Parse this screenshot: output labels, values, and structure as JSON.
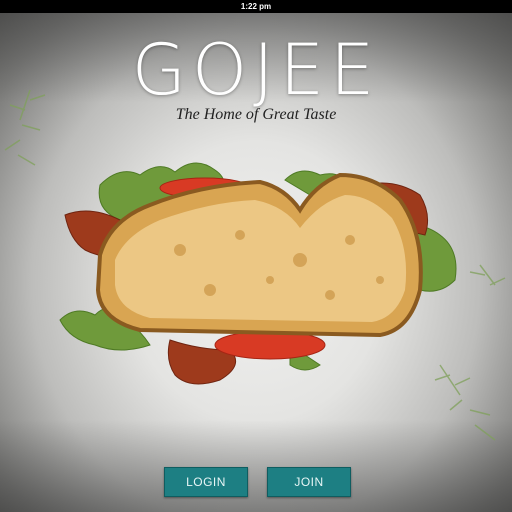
{
  "status_bar": {
    "time": "1:22 pm"
  },
  "app": {
    "logo": "GOJEE",
    "tagline": "The Home of Great Taste"
  },
  "buttons": {
    "login_label": "LOGIN",
    "join_label": "JOIN"
  },
  "colors": {
    "button_teal": "#1d7f83",
    "background": "#e4e4e2"
  },
  "hero_image": {
    "subject": "sandwich-photo"
  }
}
